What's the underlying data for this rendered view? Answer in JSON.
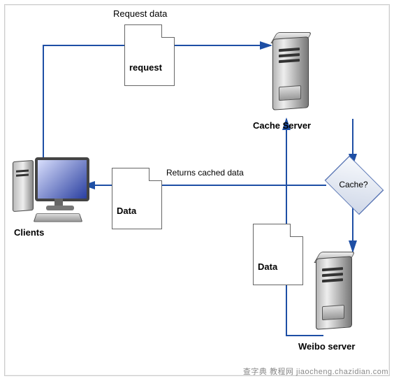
{
  "title_request_data": "Request data",
  "doc_request": "request",
  "doc_data1": "Data",
  "doc_data2": "Data",
  "returns_cached": "Returns cached data",
  "node_clients": "Clients",
  "node_cache_server": "Cache Server",
  "node_weibo_server": "Weibo server",
  "decision_label": "Cache?",
  "watermark": "查字典 教程网 jiaocheng.chazidian.com",
  "colors": {
    "arrow": "#1e4fa5"
  }
}
